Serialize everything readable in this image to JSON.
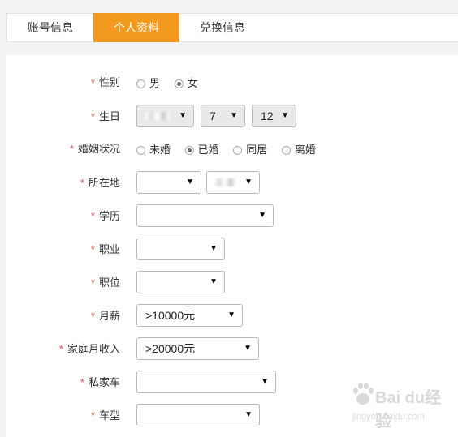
{
  "tabs": [
    {
      "label": "账号信息",
      "active": false
    },
    {
      "label": "个人资料",
      "active": true
    },
    {
      "label": "兑换信息",
      "active": false
    }
  ],
  "colors": {
    "accent": "#f39a1e",
    "required": "#d9534f"
  },
  "form": {
    "gender": {
      "label": "性别",
      "options": [
        "男",
        "女"
      ],
      "selected": "女"
    },
    "birthday": {
      "label": "生日",
      "month": "7",
      "day": "12"
    },
    "marital": {
      "label": "婚姻状况",
      "options": [
        "未婚",
        "已婚",
        "同居",
        "离婚"
      ],
      "selected": "已婚"
    },
    "location": {
      "label": "所在地"
    },
    "education": {
      "label": "学历"
    },
    "occupation": {
      "label": "职业"
    },
    "position": {
      "label": "职位"
    },
    "salary": {
      "label": "月薪",
      "value": ">10000元"
    },
    "family_income": {
      "label": "家庭月收入",
      "value": ">20000元"
    },
    "private_car": {
      "label": "私家车"
    },
    "car_model": {
      "label": "车型"
    }
  },
  "required_mark": "*",
  "watermark": {
    "text1": "Bai du经验",
    "text2": "jingyan.baidu.com"
  },
  "icons": {
    "dropdown": "chevron-down-icon"
  }
}
